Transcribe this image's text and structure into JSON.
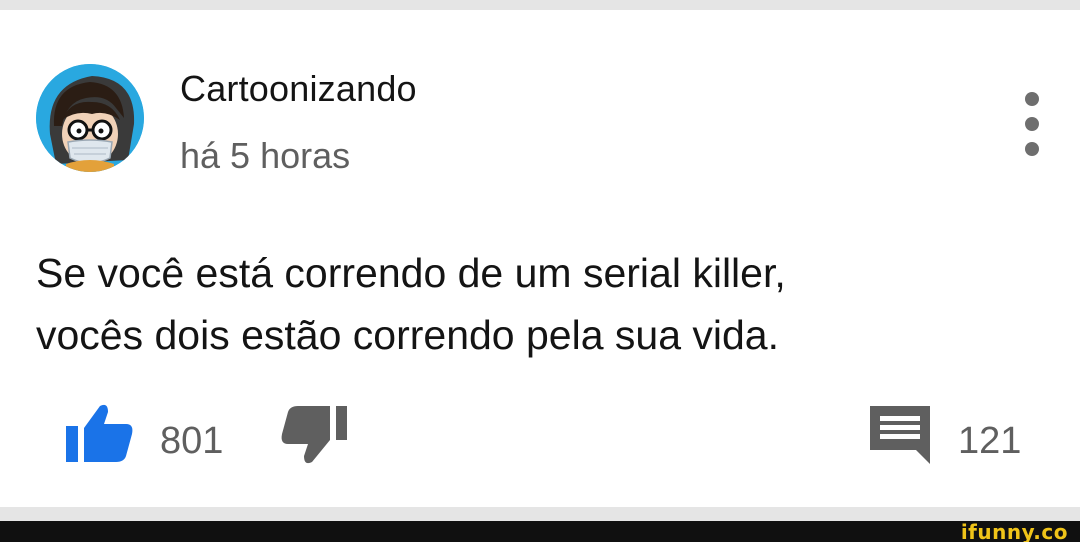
{
  "comment": {
    "author": "Cartoonizando",
    "timestamp": "há 5 horas",
    "text_line1": "Se você está correndo de um serial killer,",
    "text_line2": "vocês dois estão correndo pela sua vida.",
    "likes": "801",
    "replies": "121"
  },
  "icons": {
    "avatar": "avatar",
    "menu": "more-vertical-icon",
    "like": "thumbs-up-icon",
    "dislike": "thumbs-down-icon",
    "reply": "comment-icon"
  },
  "colors": {
    "like_active": "#1a73e8",
    "icon_gray": "#5f5f5f",
    "avatar_bg": "#29a8e0",
    "watermark": "#f0c419"
  },
  "watermark": "ifunny.co"
}
